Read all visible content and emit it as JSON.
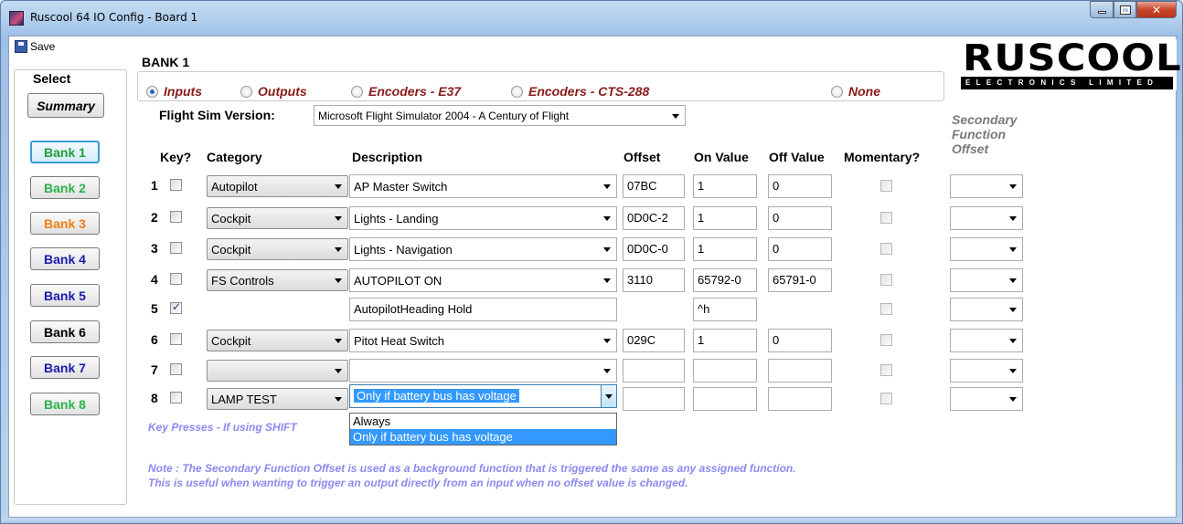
{
  "window": {
    "title": "Ruscool 64 IO Config - Board 1"
  },
  "toolbar": {
    "save_label": "Save"
  },
  "sidebar": {
    "title": "Select",
    "summary_label": "Summary",
    "banks": [
      {
        "label": "Bank 1",
        "color": "#1f9e3a"
      },
      {
        "label": "Bank 2",
        "color": "#2db34a"
      },
      {
        "label": "Bank 3",
        "color": "#f07d14"
      },
      {
        "label": "Bank 4",
        "color": "#1a1ab0"
      },
      {
        "label": "Bank 5",
        "color": "#1a1ab0"
      },
      {
        "label": "Bank 6",
        "color": "#000000"
      },
      {
        "label": "Bank 7",
        "color": "#1a1ab0"
      },
      {
        "label": "Bank 8",
        "color": "#2db34a"
      }
    ]
  },
  "logo": {
    "main": "RUSCOOL",
    "sub": "ELECTRONICS LIMITED"
  },
  "bank": {
    "title": "BANK 1",
    "modes": [
      {
        "label": "Inputs",
        "selected": true
      },
      {
        "label": "Outputs",
        "selected": false
      },
      {
        "label": "Encoders - E37",
        "selected": false
      },
      {
        "label": "Encoders - CTS-288",
        "selected": false
      },
      {
        "label": "None",
        "selected": false
      }
    ]
  },
  "flight_sim": {
    "label": "Flight Sim Version:",
    "value": "Microsoft Flight Simulator 2004 - A Century of Flight"
  },
  "columns": {
    "key": "Key?",
    "category": "Category",
    "description": "Description",
    "offset": "Offset",
    "on_value": "On Value",
    "off_value": "Off Value",
    "momentary": "Momentary?",
    "secondary_l1": "Secondary",
    "secondary_l2": "Function",
    "secondary_l3": "Offset"
  },
  "rows": [
    {
      "num": "1",
      "key": false,
      "category": "Autopilot",
      "description": "AP Master Switch",
      "offset": "07BC",
      "on": "1",
      "off": "0"
    },
    {
      "num": "2",
      "key": false,
      "category": "Cockpit",
      "description": "Lights - Landing",
      "offset": "0D0C-2",
      "on": "1",
      "off": "0"
    },
    {
      "num": "3",
      "key": false,
      "category": "Cockpit",
      "description": "Lights - Navigation",
      "offset": "0D0C-0",
      "on": "1",
      "off": "0"
    },
    {
      "num": "4",
      "key": false,
      "category": "FS Controls",
      "description": "AUTOPILOT ON",
      "offset": "3110",
      "on": "65792-0",
      "off": "65791-0"
    },
    {
      "num": "5",
      "key": true,
      "category": "",
      "description": "AutopilotHeading Hold",
      "offset": "",
      "on": "^h",
      "off": ""
    },
    {
      "num": "6",
      "key": false,
      "category": "Cockpit",
      "description": "Pitot Heat Switch",
      "offset": "029C",
      "on": "1",
      "off": "0"
    },
    {
      "num": "7",
      "key": false,
      "category": "",
      "description": "",
      "offset": "",
      "on": "",
      "off": ""
    },
    {
      "num": "8",
      "key": false,
      "category": "LAMP TEST",
      "description": "Only if battery bus has voltage",
      "offset": "",
      "on": "",
      "off": ""
    }
  ],
  "dropdown": {
    "options": [
      "Always",
      "Only if battery bus has voltage"
    ]
  },
  "notes": {
    "key_presses": "Key Presses - If using SHIFT",
    "line1": "Note : The Secondary Function Offset is used as a background function that is triggered the same as any assigned function.",
    "line2": "This is useful when wanting to trigger an output directly from an input when no offset value is changed."
  }
}
